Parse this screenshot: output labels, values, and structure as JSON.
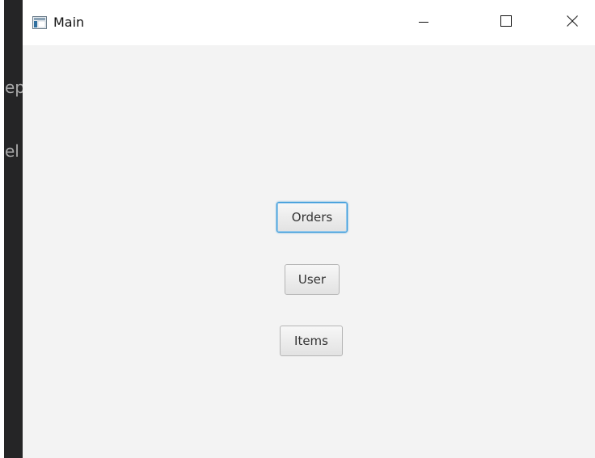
{
  "background_window": {
    "text_lines": [
      "ep",
      "el"
    ]
  },
  "window": {
    "title": "Main",
    "app_icon": "java-app-icon",
    "controls": {
      "minimize_icon": "minimize-icon",
      "maximize_icon": "maximize-icon",
      "close_icon": "close-icon"
    }
  },
  "buttons": {
    "orders": "Orders",
    "user": "User",
    "items": "Items"
  },
  "colors": {
    "focus_ring": "#3a9ad9",
    "content_background": "#f3f3f3",
    "titlebar_background": "#ffffff"
  }
}
